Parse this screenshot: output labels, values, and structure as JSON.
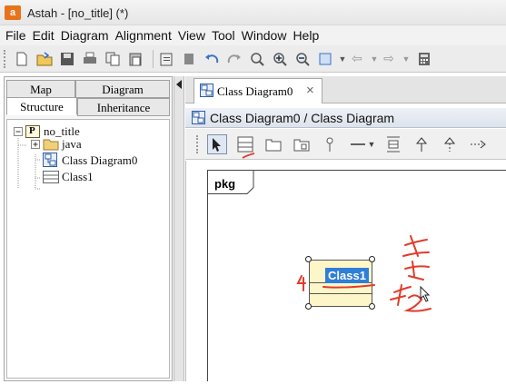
{
  "window": {
    "app_icon": "astah-icon",
    "title": "Astah - [no_title] (*)"
  },
  "menu": [
    "File",
    "Edit",
    "Diagram",
    "Alignment",
    "View",
    "Tool",
    "Window",
    "Help"
  ],
  "left_panel": {
    "tabs_top": [
      "Map",
      "Diagram"
    ],
    "tabs_bottom": [
      "Structure",
      "Inheritance"
    ],
    "active_tab": "Structure",
    "tree": {
      "root": "no_title",
      "root_badge": "P",
      "children": [
        "java",
        "Class Diagram0",
        "Class1"
      ]
    }
  },
  "editor": {
    "tab_label": "Class Diagram0",
    "tab_close": "×",
    "header": "Class Diagram0 / Class Diagram",
    "package_label": "pkg",
    "class_name": "Class1"
  },
  "annotations": {
    "ink_color": "#e23b2a"
  }
}
